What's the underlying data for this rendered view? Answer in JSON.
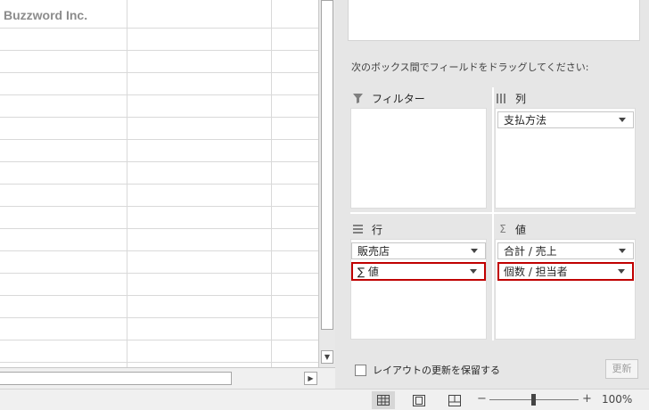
{
  "sheet": {
    "cell_text": "Buzzword Inc."
  },
  "pivot": {
    "drag_instruction": "次のボックス間でフィールドをドラッグしてください:",
    "areas": {
      "filter": {
        "title": "フィルター",
        "icon": "funnel-icon"
      },
      "columns": {
        "title": "列",
        "icon": "columns-icon",
        "items": [
          "支払方法"
        ]
      },
      "rows": {
        "title": "行",
        "icon": "rows-icon",
        "items": [
          "販売店",
          "∑ 値"
        ]
      },
      "values": {
        "title": "値",
        "icon": "sigma-icon",
        "items": [
          "合計 / 売上",
          "個数 / 担当者"
        ]
      }
    },
    "defer_update_label": "レイアウトの更新を保留する",
    "update_button": "更新"
  },
  "status_bar": {
    "zoom_minus": "−",
    "zoom_plus": "+",
    "zoom_percent": "100%",
    "view_buttons": [
      "normal-view-icon",
      "page-layout-view-icon",
      "page-break-preview-icon"
    ]
  },
  "colors": {
    "selection_border": "#c00000",
    "panel_bg": "#e6e6e6",
    "gridline": "#d9d9d9",
    "cell_text": "#8c8c8c"
  }
}
